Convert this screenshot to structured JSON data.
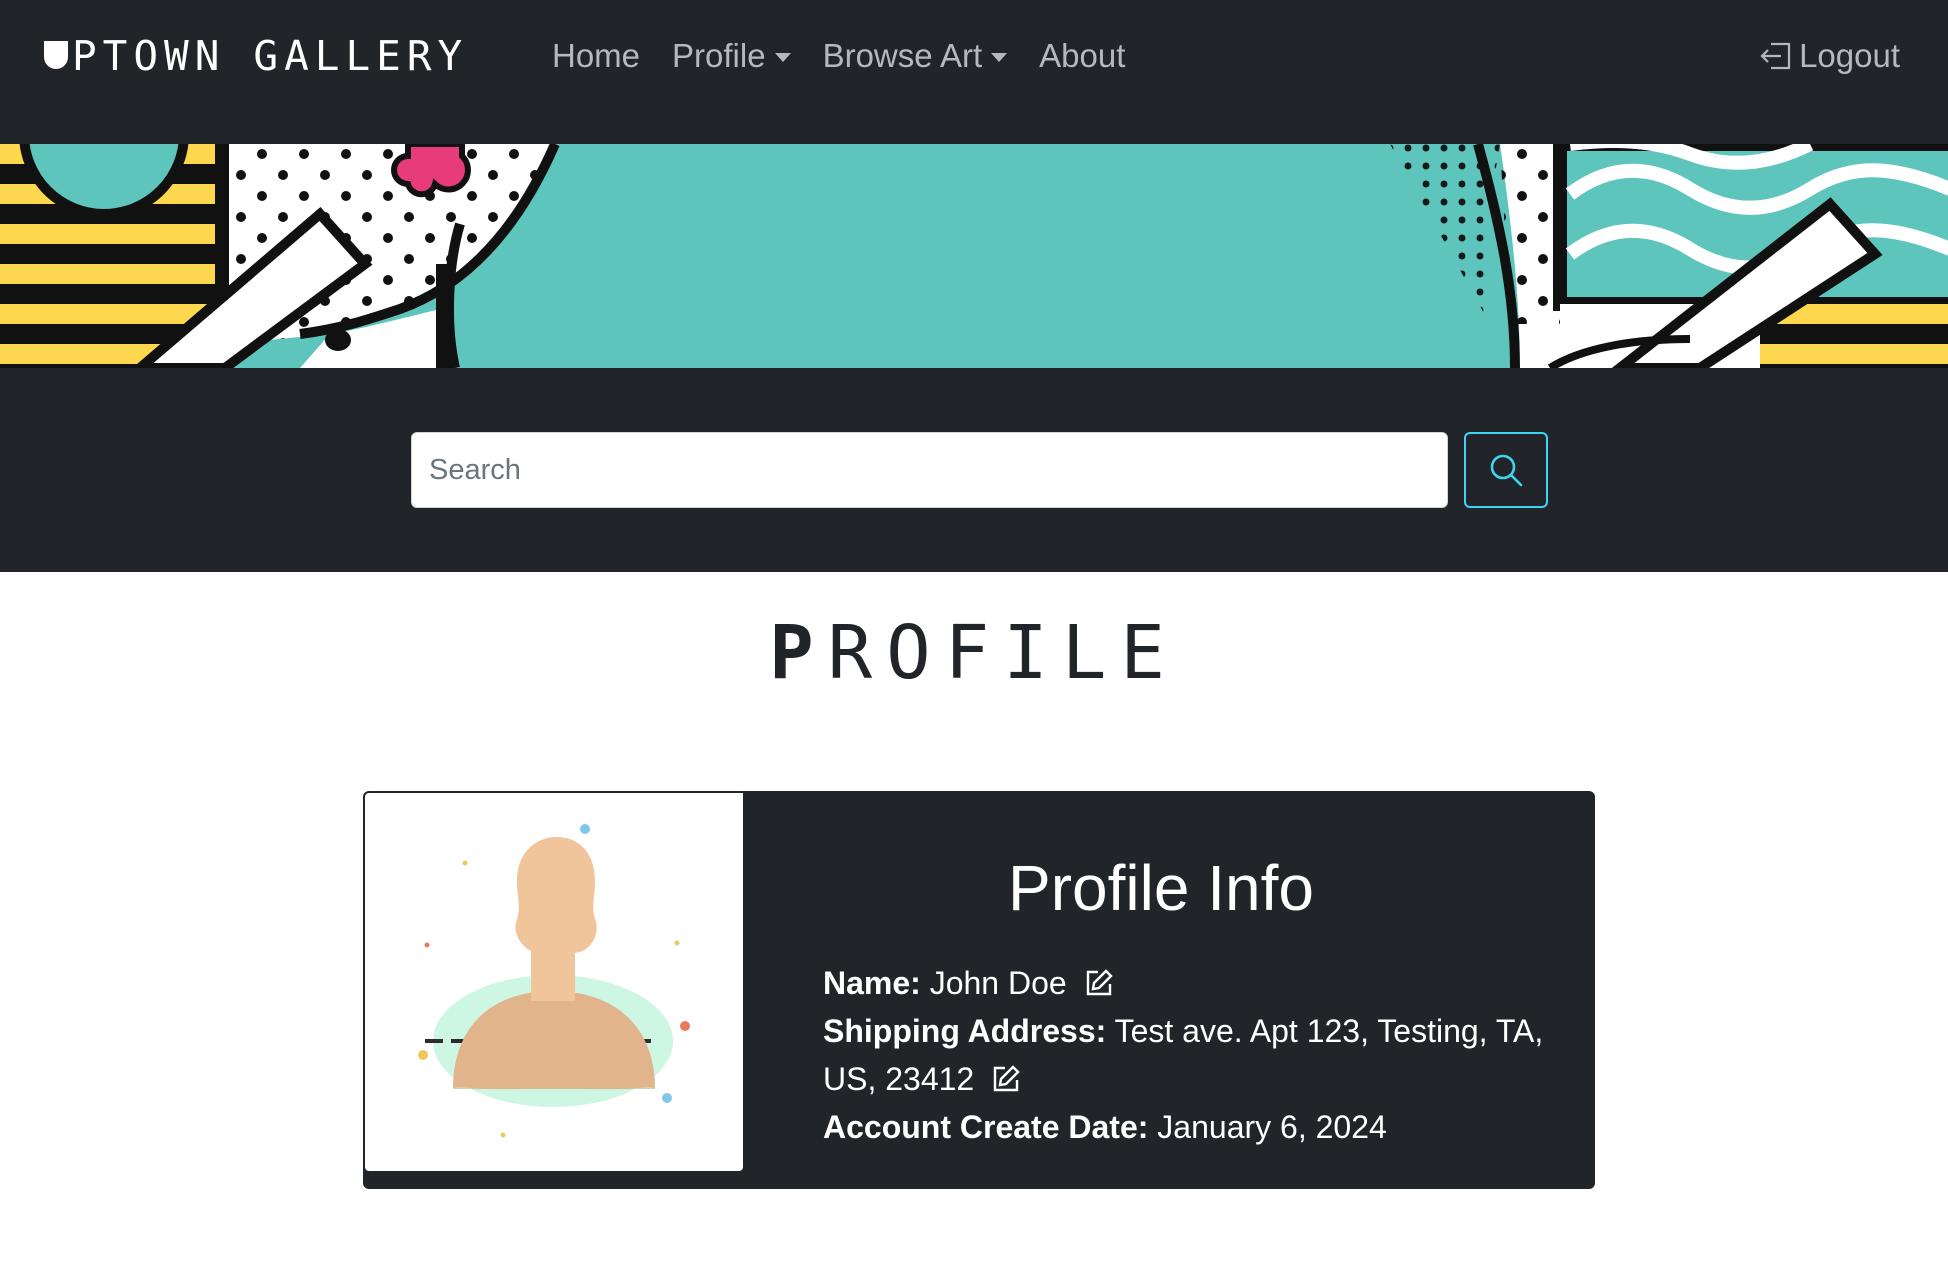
{
  "app": {
    "brand": {
      "first": "U",
      "word1": "PTOWN",
      "word2": "GALLERY"
    }
  },
  "nav": {
    "items": [
      {
        "label": "Home",
        "dropdown": false
      },
      {
        "label": "Profile",
        "dropdown": true
      },
      {
        "label": "Browse Art",
        "dropdown": true
      },
      {
        "label": "About",
        "dropdown": false
      }
    ],
    "logout_label": "Logout"
  },
  "search": {
    "placeholder": "Search",
    "value": "",
    "button_icon": "search-icon",
    "accent": "#3dd5f3"
  },
  "page": {
    "title_first": "P",
    "title_rest": "ROFILE"
  },
  "profile": {
    "card_title": "Profile Info",
    "name_label": "Name:",
    "name_value": "John Doe",
    "address_label": "Shipping Address:",
    "address_value": "Test ave. Apt 123, Testing, TA, US, 23412",
    "created_label": "Account Create Date:",
    "created_value": "January 6, 2024",
    "edit_icon": "pencil-square-icon"
  },
  "colors": {
    "navbar_bg": "#212529",
    "nav_text": "#b5b8bc",
    "teal": "#5ec5bd",
    "yellow": "#fdd84e",
    "pink": "#e83c7a"
  }
}
